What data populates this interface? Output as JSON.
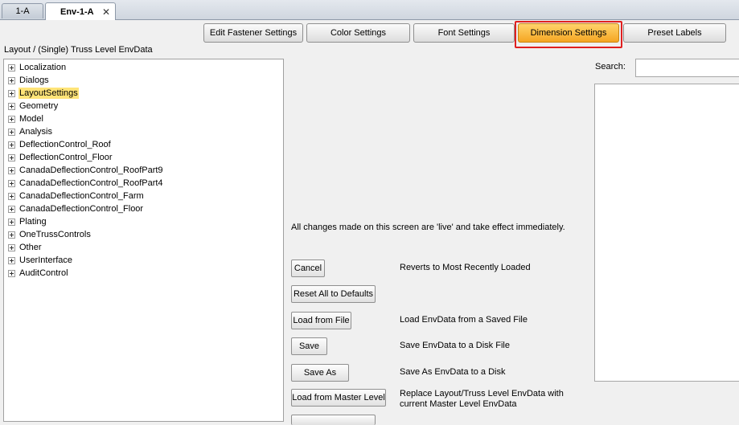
{
  "tabs": [
    {
      "label": "1-A"
    },
    {
      "label": "Env-1-A",
      "close": "✕"
    }
  ],
  "toolbar": {
    "buttons": [
      {
        "label": "Edit Fastener Settings"
      },
      {
        "label": "Color Settings"
      },
      {
        "label": "Font Settings"
      },
      {
        "label": "Dimension Settings"
      },
      {
        "label": "Preset Labels"
      }
    ]
  },
  "tree": {
    "caption": "Layout / (Single) Truss Level EnvData",
    "items": [
      {
        "label": "Localization"
      },
      {
        "label": "Dialogs"
      },
      {
        "label": "LayoutSettings"
      },
      {
        "label": "Geometry"
      },
      {
        "label": "Model"
      },
      {
        "label": "Analysis"
      },
      {
        "label": "DeflectionControl_Roof"
      },
      {
        "label": "DeflectionControl_Floor"
      },
      {
        "label": "CanadaDeflectionControl_RoofPart9"
      },
      {
        "label": "CanadaDeflectionControl_RoofPart4"
      },
      {
        "label": "CanadaDeflectionControl_Farm"
      },
      {
        "label": "CanadaDeflectionControl_Floor"
      },
      {
        "label": "Plating"
      },
      {
        "label": "OneTrussControls"
      },
      {
        "label": "Other"
      },
      {
        "label": "UserInterface"
      },
      {
        "label": "AuditControl"
      }
    ]
  },
  "main": {
    "live_note": "All changes made on this screen are 'live' and take effect immediately.",
    "actions": [
      {
        "label": "Cancel",
        "desc": "Reverts to Most Recently Loaded"
      },
      {
        "label": "Reset All to Defaults",
        "desc": ""
      },
      {
        "label": "Load from File",
        "desc": "Load EnvData from a Saved File"
      },
      {
        "label": "Save",
        "desc": "Save EnvData to a Disk File"
      },
      {
        "label": "Save As",
        "desc": "Save As EnvData to a Disk"
      },
      {
        "label": "Load from Master Level",
        "desc": "Replace Layout/Truss Level EnvData with current Master Level EnvData"
      }
    ]
  },
  "search": {
    "label": "Search:",
    "value": ""
  }
}
